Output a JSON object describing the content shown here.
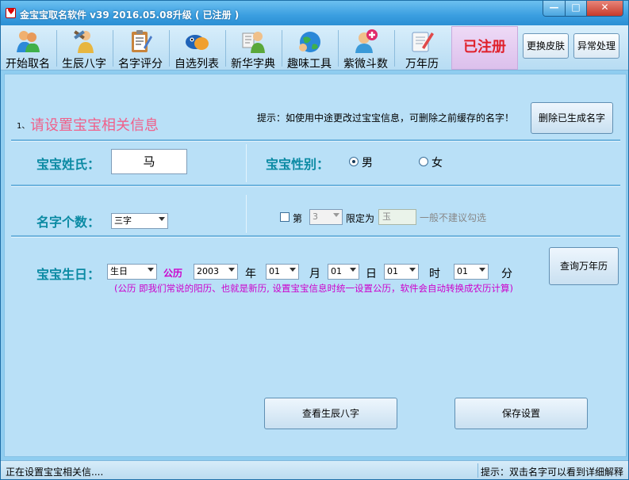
{
  "window": {
    "title": "金宝宝取名软件 v39  2016.05.08升级 ( 已注册 )",
    "controls": {
      "minimize": "—",
      "maximize": "□",
      "close": "✕"
    }
  },
  "toolbar": {
    "items": [
      {
        "label": "开始取名",
        "icon": "people-icon"
      },
      {
        "label": "生辰八字",
        "icon": "tools-person-icon"
      },
      {
        "label": "名字评分",
        "icon": "clipboard-icon"
      },
      {
        "label": "自选列表",
        "icon": "fish-icon"
      },
      {
        "label": "新华字典",
        "icon": "reader-icon"
      },
      {
        "label": "趣味工具",
        "icon": "globe-icon"
      },
      {
        "label": "紫微斗数",
        "icon": "medic-icon"
      },
      {
        "label": "万年历",
        "icon": "notebook-pen-icon"
      }
    ],
    "registered_label": "已注册",
    "change_skin": "更换皮肤",
    "exception": "异常处理"
  },
  "section1": {
    "step_number": "1、",
    "step_title": "请设置宝宝相关信息",
    "hint": "提示：如使用中途更改过宝宝信息，可删除之前缓存的名字！",
    "delete_button": "删除已生成名字"
  },
  "surname": {
    "label": "宝宝姓氏：",
    "value": "马"
  },
  "gender": {
    "label": "宝宝性别：",
    "options": [
      "男",
      "女"
    ],
    "selected": "男"
  },
  "name_count": {
    "label": "名字个数：",
    "value": "三字",
    "fixed_position_prefix": "第",
    "position_value": "3",
    "limit_label": "限定为",
    "limit_value": "玉",
    "not_recommended": "一般不建议勾选"
  },
  "birthday": {
    "label": "宝宝生日：",
    "type_value": "生日",
    "calendar": "公历",
    "year": "2003",
    "year_unit": "年",
    "month": "01",
    "month_unit": "月",
    "day": "01",
    "day_unit": "日",
    "hour": "01",
    "hour_unit": "时",
    "minute": "01",
    "minute_unit": "分",
    "calendar_button": "查询万年历",
    "note": "(公历  即我们常说的阳历、也就是新历, 设置宝宝信息时统一设置公历，软件会自动转换成农历计算)"
  },
  "actions": {
    "view_bazi": "查看生辰八字",
    "save_settings": "保存设置"
  },
  "status": {
    "left": "正在设置宝宝相关信....",
    "right": "提示：双击名字可以看到详细解释"
  }
}
